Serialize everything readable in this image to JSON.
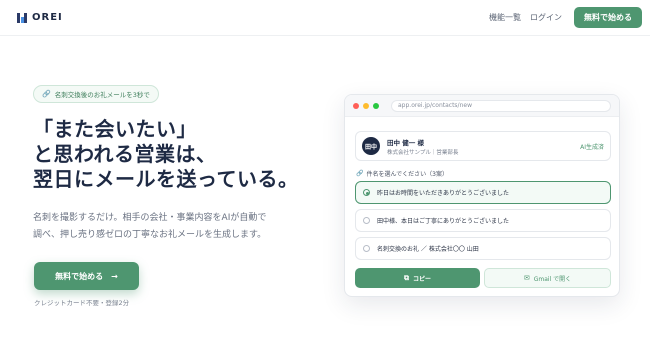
{
  "nav": {
    "logo_text": "OREI",
    "features_link": "機能一覧",
    "login_link": "ログイン",
    "cta_label": "無料で始める"
  },
  "hero": {
    "tag": "名刺交換後のお礼メールを3秒で",
    "title_lines": [
      "「また会いたい」",
      "と思われる営業は、",
      "翌日にメールを送っている。"
    ],
    "desc_lines": [
      "名刺を撮影するだけ。相手の会社・事業内容をAIが自動で",
      "調べ、押し売り感ゼロの丁寧なお礼メールを生成します。"
    ],
    "cta_label": "無料で始める",
    "cta_arrow": "→",
    "note": "クレジットカード不要・登録2分"
  },
  "mock": {
    "url": "app.orei.jp/contacts/new",
    "contact": {
      "avatar": "田中",
      "name": "田中 健一 様",
      "company": "株式会社サンプル｜営業部長",
      "ai_badge": "AI生成済"
    },
    "subject_label": "件名を選んでください（3案）",
    "options": [
      {
        "label": "昨日はお時間をいただきありがとうございました",
        "selected": true
      },
      {
        "label": "田中様、本日はご丁寧にありがとうございました",
        "selected": false
      },
      {
        "label": "名刺交換のお礼 ／ 株式会社〇〇 山田",
        "selected": false
      }
    ],
    "copy_label": "コピー",
    "gmail_label": "Gmail で開く"
  },
  "colors": {
    "brand_green": "#4e9670",
    "navy": "#1e2a44"
  }
}
